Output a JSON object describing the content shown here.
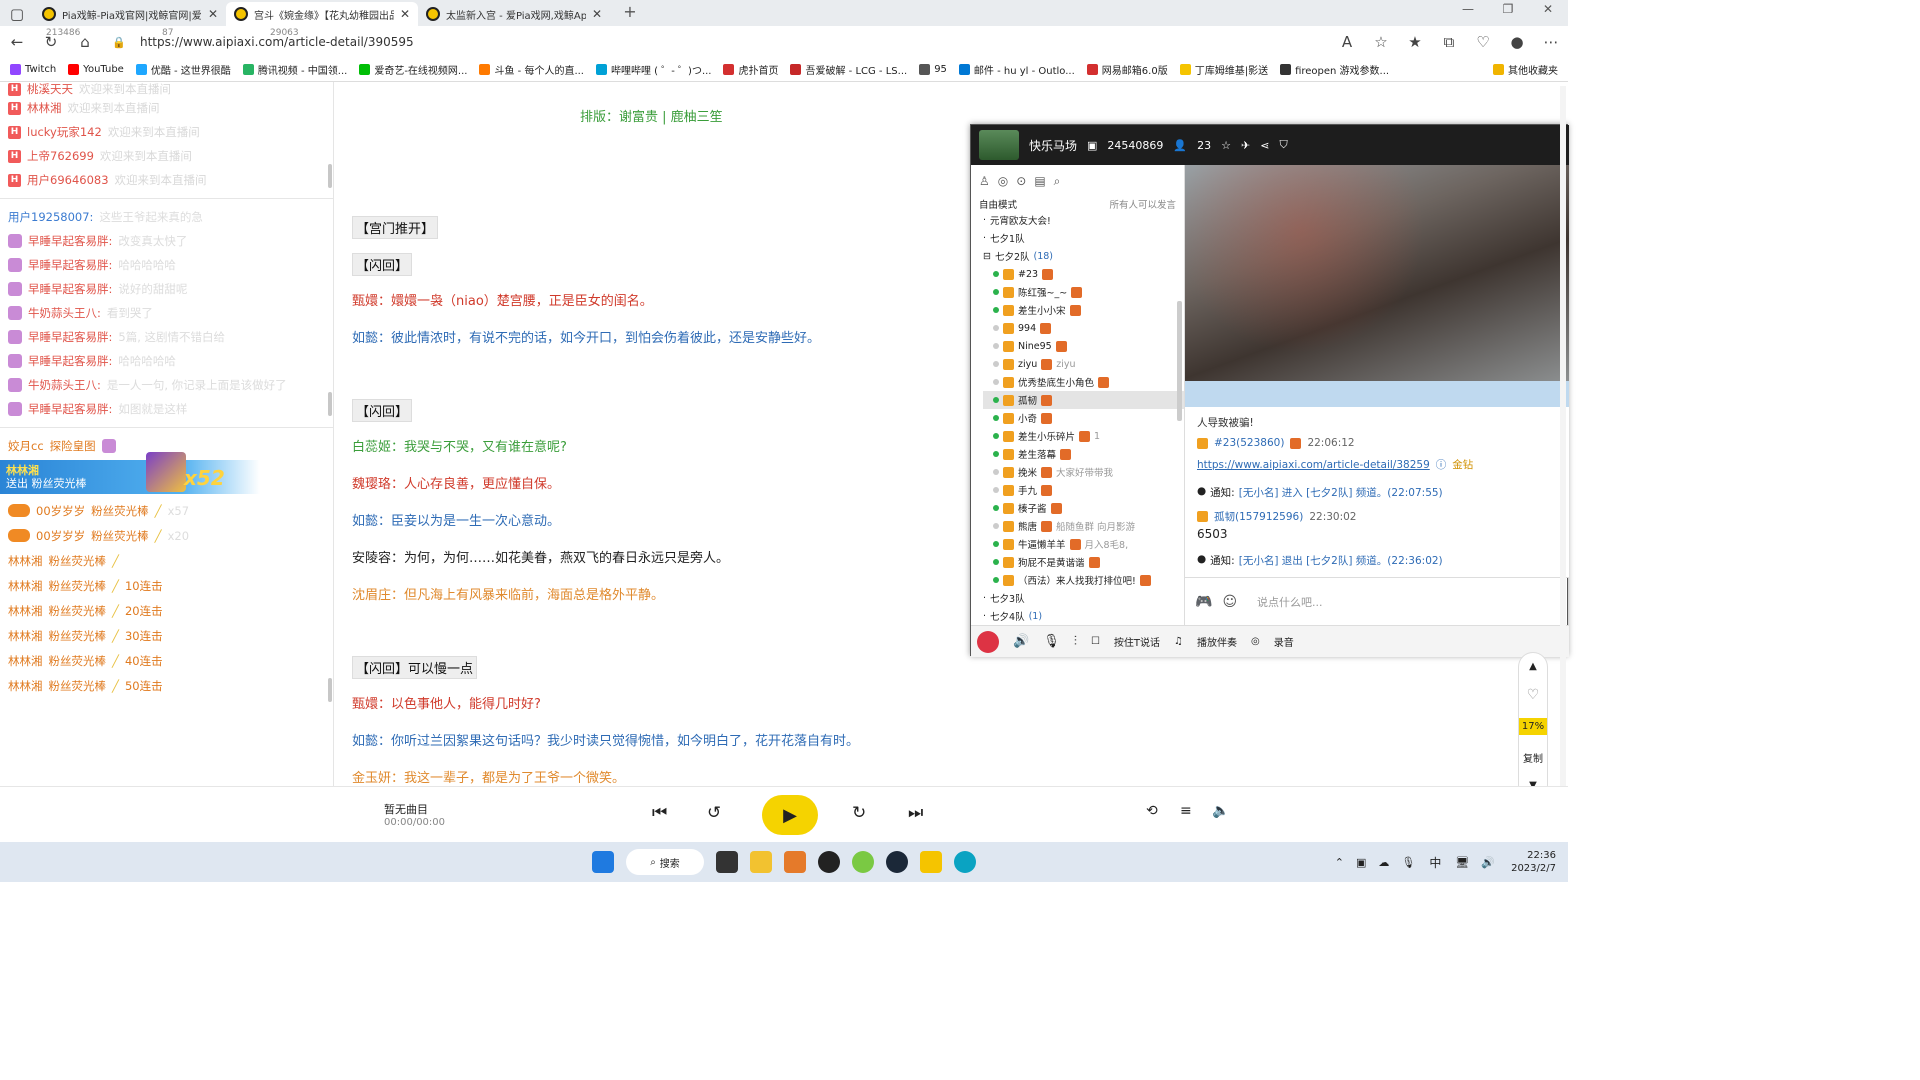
{
  "tabs": [
    {
      "title": "Pia戏鲸-Pia戏官网|戏鲸官网|爱Pi"
    },
    {
      "title": "宫斗《婉金缘》【花丸幼稚园出品】"
    },
    {
      "title": "太监新入宫 - 爱Pia戏网,戏鲸App"
    }
  ],
  "address": {
    "url": "https://www.aipiaxi.com/article-detail/390595",
    "counter1": "213486",
    "counter2": "87",
    "counter3": "29063"
  },
  "bookmarks": [
    "Twitch",
    "YouTube",
    "优酷 - 这世界很酷",
    "腾讯视频 - 中国领...",
    "爱奇艺-在线视频网...",
    "斗鱼 - 每个人的直...",
    "哔哩哔哩 ( ゜- ゜)つ...",
    "虎扑首页",
    "吾爱破解 - LCG - LS...",
    "95",
    "邮件 - hu yl - Outlo...",
    "网易邮箱6.0版",
    "丁库姆维基|影送",
    "fireopen 游戏参数...",
    "其他收藏夹"
  ],
  "leftchat": {
    "top_users": [
      "桃溪天天",
      "林林湘",
      "lucky玩家142",
      "上帝762699",
      "用户69646083"
    ],
    "enter_suffix": "欢迎来到本直播间",
    "line_user": "用户19258007:",
    "line_user_text": "这些王爷起来真的急",
    "fan_msgs": [
      {
        "u": "早睡早起客易胖:",
        "t": "改变真太快了"
      },
      {
        "u": "早睡早起客易胖:",
        "t": "哈哈哈哈哈"
      },
      {
        "u": "早睡早起客易胖:",
        "t": "说好的甜甜呢"
      },
      {
        "u": "牛奶蒜头王八:",
        "t": "看到哭了"
      },
      {
        "u": "早睡早起客易胖:",
        "t": "5篇, 这剧情不错白给"
      },
      {
        "u": "早睡早起客易胖:",
        "t": "哈哈哈哈哈"
      },
      {
        "u": "牛奶蒜头王八:",
        "t": "是一人一句, 你记录上面是该做好了"
      },
      {
        "u": "早睡早起客易胖:",
        "t": "如图就是这样"
      }
    ],
    "gift_user1": "姣月cc",
    "gift_label1": "探险皇图",
    "gift_banner_user": "林林湘",
    "gift_banner_text": "送出  粉丝荧光棒",
    "gift_banner_count": "x52",
    "gift_rows": [
      {
        "u": "00岁岁岁",
        "g": "粉丝荧光棒",
        "c": "x57"
      },
      {
        "u": "00岁岁岁",
        "g": "粉丝荧光棒",
        "c": "x20"
      },
      {
        "u": "林林湘",
        "g": "粉丝荧光棒",
        "c": ""
      },
      {
        "u": "林林湘",
        "g": "粉丝荧光棒",
        "c": "10连击"
      },
      {
        "u": "林林湘",
        "g": "粉丝荧光棒",
        "c": "20连击"
      },
      {
        "u": "林林湘",
        "g": "粉丝荧光棒",
        "c": "30连击"
      },
      {
        "u": "林林湘",
        "g": "粉丝荧光棒",
        "c": "40连击"
      },
      {
        "u": "林林湘",
        "g": "粉丝荧光棒",
        "c": "50连击"
      }
    ]
  },
  "article": {
    "layout": "排版：谢富贵 | 鹿柚三笙",
    "lines": [
      {
        "k": "tag",
        "t": "【宫门推开】"
      },
      {
        "k": "tag",
        "t": "【闪回】"
      },
      {
        "k": "red",
        "t": "甄嬛：嬛嬛一袅（niao）楚宫腰，正是臣女的闺名。"
      },
      {
        "k": "blue",
        "t": "如懿：彼此情浓时，有说不完的话，如今开口，到怕会伤着彼此，还是安静些好。"
      },
      {
        "k": "tag",
        "t": "【闪回】"
      },
      {
        "k": "green",
        "t": "白蕊姬：我哭与不哭，又有谁在意呢?"
      },
      {
        "k": "red",
        "t": "魏璎珞：人心存良善，更应懂自保。"
      },
      {
        "k": "blue",
        "t": "如懿：臣妾以为是一生一次心意动。"
      },
      {
        "k": "black",
        "t": "安陵容：为何，为何……如花美眷，燕双飞的春日永远只是旁人。"
      },
      {
        "k": "orange",
        "t": "沈眉庄：但凡海上有风暴来临前，海面总是格外平静。"
      },
      {
        "k": "tag",
        "t": "【闪回】可以慢一点"
      },
      {
        "k": "red",
        "t": "甄嬛：以色事他人，能得几时好?"
      },
      {
        "k": "blue",
        "t": "如懿：你听过兰因絮果这句话吗？我少时读只觉得惋惜，如今明白了，花开花落自有时。"
      },
      {
        "k": "orange",
        "t": "金玉妍：我这一辈子，都是为了王爷一个微笑。"
      }
    ]
  },
  "voice": {
    "room_name": "快乐马场",
    "room_id": "24540869",
    "online": "23",
    "mode": "自由模式",
    "mode_hint": "所有人可以发言",
    "channels": [
      {
        "name": "元宵欧友大会!"
      },
      {
        "name": "七夕1队"
      },
      {
        "name": "七夕2队",
        "count": "(18)"
      }
    ],
    "members": [
      "#23",
      "陈红强~_~",
      "差生小小宋",
      "994",
      "Nine95",
      "ziyu",
      "优秀垫底生小角色",
      "孤韧",
      "小奇",
      "差生小乐碎片",
      "差生落幕",
      "挽米",
      "手九",
      "楱子酱",
      "熊唐",
      "牛逼懒羊羊",
      "狗屁不是黄谐谐",
      "（西法）来人找我打排位吧!"
    ],
    "member_notes": {
      "ziyu": "ziyu",
      "差生小乐碎片": "1",
      "挽米": "大家好带带我",
      "熊唐": "船随鱼群 向月影游",
      "牛逼懒羊羊": "月入8毛8,"
    },
    "channels_after": [
      {
        "name": "七夕3队"
      },
      {
        "name": "七夕4队",
        "count": "(1)"
      }
    ],
    "chat": {
      "intro": "人导致被骗!",
      "m1_user": "#23(523860)",
      "m1_time": "22:06:12",
      "m1_link": "https://www.aipiaxi.com/article-detail/38259",
      "m1_tag": "金钻",
      "n1_label": "通知:",
      "n1_text": "[无小名] 进入 [七夕2队] 频道。(22:07:55)",
      "m2_user": "孤韧(157912596)",
      "m2_time": "22:30:02",
      "m2_text": "6503",
      "n2_label": "通知:",
      "n2_text": "[无小名] 退出 [七夕2队] 频道。(22:36:02)"
    },
    "input_placeholder": "说点什么吧...",
    "bottom": {
      "ptt": "按住T说话",
      "accompany": "播放伴奏",
      "record": "录音"
    }
  },
  "sidetools": {
    "percent": "17%",
    "copy": "复制"
  },
  "player": {
    "title": "暂无曲目",
    "time": "00:00/00:00"
  },
  "taskbar": {
    "search": "搜索",
    "ime": "中",
    "time": "22:36",
    "date": "2023/2/7"
  },
  "colors": {
    "red": "#d03a2b",
    "blue": "#2e6bb5",
    "green": "#3a9d3a",
    "orange": "#e08a2e",
    "accent": "#f5d300"
  }
}
